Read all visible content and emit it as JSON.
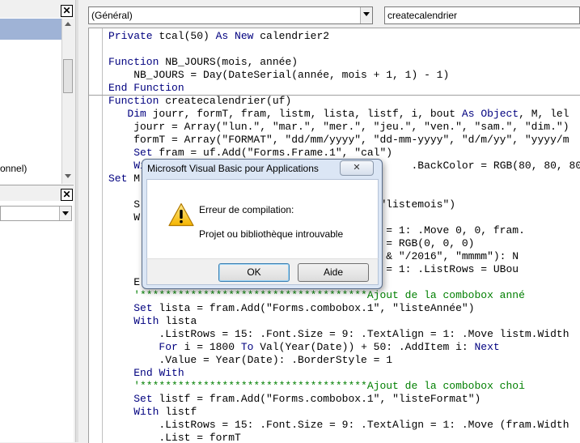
{
  "left_panes": {
    "project_item_text": "onnel)",
    "close_glyph": "✕"
  },
  "code_window": {
    "object_combo_value": "(Général)",
    "procedure_combo_value": "createcalendrier",
    "code_lines": [
      {
        "text": "Private tcal(50) As New calendrier2",
        "kind": "code",
        "sep": false
      },
      {
        "text": "",
        "kind": "code",
        "sep": false
      },
      {
        "text": "Function NB_JOURS(mois, année)",
        "kind": "code",
        "sep": false
      },
      {
        "text": "    NB_JOURS = Day(DateSerial(année, mois + 1, 1) - 1)",
        "kind": "code",
        "sep": false
      },
      {
        "text": "End Function",
        "kind": "code",
        "sep": false
      },
      {
        "text": "Function createcalendrier(uf)",
        "kind": "code",
        "sep": true
      },
      {
        "text": "   Dim jourr, formT, fram, listm, lista, listf, i, bout As Object, M, lel",
        "kind": "code",
        "sep": false
      },
      {
        "text": "    jourr = Array(\"lun.\", \"mar.\", \"mer.\", \"jeu.\", \"ven.\", \"sam.\", \"dim.\")",
        "kind": "code",
        "sep": false
      },
      {
        "text": "    formT = Array(\"FORMAT\", \"dd/mm/yyyy\", \"dd-mm-yyyy\", \"d/m/yy\", \"yyyy/m",
        "kind": "code",
        "sep": false
      },
      {
        "text": "    Set fram = uf.Add(\"Forms.Frame.1\", \"cal\")",
        "kind": "code",
        "sep": false
      },
      {
        "text": "    With                                        .BackColor = RGB(80, 80, 80):",
        "kind": "code",
        "sep": false
      },
      {
        "text": "Set M",
        "kind": "code",
        "sep": false
      },
      {
        "text": "",
        "kind": "code",
        "sep": false
      },
      {
        "text": "    S                                   \", \"listemois\")",
        "kind": "code",
        "sep": false
      },
      {
        "text": "    W",
        "kind": "code",
        "sep": false
      },
      {
        "text": "                                  TextAlign = 1: .Move 0, 0, fram.",
        "kind": "code",
        "sep": false
      },
      {
        "text": "                                  ForeColor = RGB(0, 0, 0)",
        "kind": "code",
        "sep": false
      },
      {
        "text": "                                  01/0\" & i & \"/2016\", \"mmmm\"): N",
        "kind": "code",
        "sep": false
      },
      {
        "text": "                                  rderStyle = 1: .ListRows = UBou",
        "kind": "code",
        "sep": false
      },
      {
        "text": "    E",
        "kind": "code",
        "sep": false
      },
      {
        "text": "    '************************************Ajout de la combobox anné",
        "kind": "comment",
        "sep": false
      },
      {
        "text": "    Set lista = fram.Add(\"Forms.combobox.1\", \"listeAnnée\")",
        "kind": "code",
        "sep": false
      },
      {
        "text": "    With lista",
        "kind": "code",
        "sep": false
      },
      {
        "text": "        .ListRows = 15: .Font.Size = 9: .TextAlign = 1: .Move listm.Width",
        "kind": "code",
        "sep": false
      },
      {
        "text": "        For i = 1800 To Val(Year(Date)) + 50: .AddItem i: Next",
        "kind": "code",
        "sep": false
      },
      {
        "text": "        .Value = Year(Date): .BorderStyle = 1",
        "kind": "code",
        "sep": false
      },
      {
        "text": "    End With",
        "kind": "code",
        "sep": false
      },
      {
        "text": "    '************************************Ajout de la combobox choi",
        "kind": "comment",
        "sep": false
      },
      {
        "text": "    Set listf = fram.Add(\"Forms.combobox.1\", \"listeFormat\")",
        "kind": "code",
        "sep": false
      },
      {
        "text": "    With listf",
        "kind": "code",
        "sep": false
      },
      {
        "text": "        .ListRows = 15: .Font.Size = 9: .TextAlign = 1: .Move (fram.Width",
        "kind": "code",
        "sep": false
      },
      {
        "text": "        .List = formT",
        "kind": "code",
        "sep": false
      }
    ],
    "keywords": [
      "Private",
      "As",
      "New",
      "Function",
      "End",
      "Dim",
      "Object",
      "Set",
      "With",
      "For",
      "To",
      "Next"
    ]
  },
  "dialog": {
    "title": "Microsoft Visual Basic pour Applications",
    "close_glyph": "✕",
    "message_title": "Erreur de compilation:",
    "message_detail": "Projet ou bibliothèque introuvable",
    "ok_label": "OK",
    "help_label": "Aide",
    "icon": "warning-icon"
  },
  "colors": {
    "keyword": "#00007f",
    "comment": "#007f00",
    "selection_band": "#9fb3d6"
  }
}
